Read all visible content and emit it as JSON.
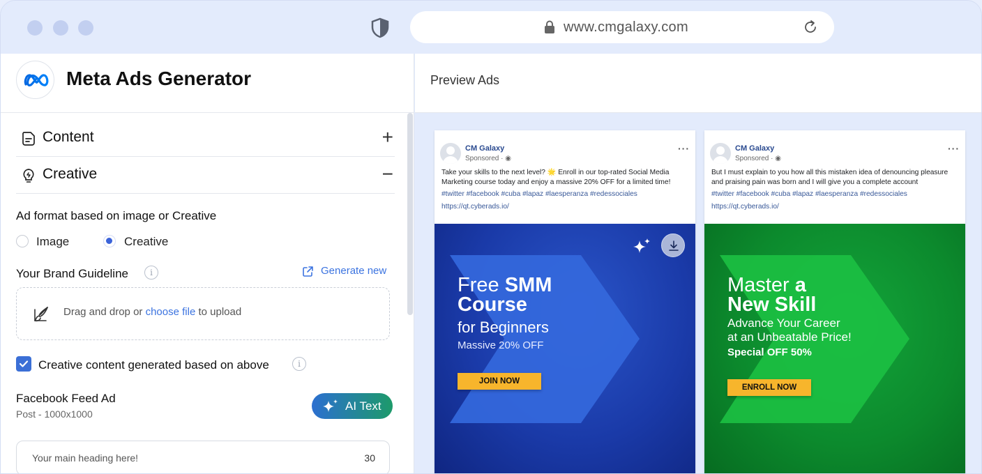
{
  "browser": {
    "url": "www.cmgalaxy.com"
  },
  "app": {
    "title": "Meta Ads Generator"
  },
  "accordion": {
    "content_label": "Content",
    "creative_label": "Creative",
    "content_sign": "+",
    "creative_sign": "−"
  },
  "form": {
    "ad_format_label": "Ad format based on image or Creative",
    "format_options": [
      "Image",
      "Creative"
    ],
    "format_selected": "Creative",
    "brand_guideline_label": "Your Brand Guideline",
    "generate_new_label": "Generate new",
    "upload_prefix": "Drag and drop or ",
    "upload_link": "choose file",
    "upload_suffix": " to upload",
    "checkbox_label": "Creative content generated based on above",
    "checkbox_checked": true,
    "ad_type_title": "Facebook Feed Ad",
    "ad_type_sub": "Post - 1000x1000",
    "ai_text_label": "AI Text",
    "heading_placeholder": "Your main heading here!",
    "heading_counter": "30"
  },
  "preview": {
    "title": "Preview Ads",
    "ads": [
      {
        "page_name": "CM Galaxy",
        "sponsored": "Sponsored · ",
        "body": "Take your skills to the next level? 🌟 Enroll in our top-rated Social Media Marketing course today and enjoy a massive 20% OFF for a limited time!",
        "tags": "#twitter #facebook #cuba #lapaz #laesperanza #redessociales",
        "link": "https://qt.cyberads.io/",
        "headline_line1_normal": "Free ",
        "headline_line1_bold": "SMM",
        "headline_line2_bold": "Course",
        "subline": "for Beginners",
        "offer": "Massive 20% OFF",
        "cta": "JOIN NOW",
        "accent": "#2a55c9"
      },
      {
        "page_name": "CM Galaxy",
        "sponsored": "Sponsored · ",
        "body": "But I must explain to you how all this mistaken idea of denouncing pleasure and praising pain was born and I will give you a complete account",
        "tags": "#twitter #facebook #cuba #lapaz #laesperanza #redessociales",
        "link": "https://qt.cyberads.io/",
        "headline_line1_normal": "Master ",
        "headline_line1_bold": "a",
        "headline_line2_bold": "New Skill",
        "subline_1": "Advance Your Career",
        "subline_2": "at an Unbeatable Price!",
        "offer": "Special OFF 50%",
        "cta": "ENROLL NOW",
        "accent": "#13a53a"
      }
    ]
  }
}
